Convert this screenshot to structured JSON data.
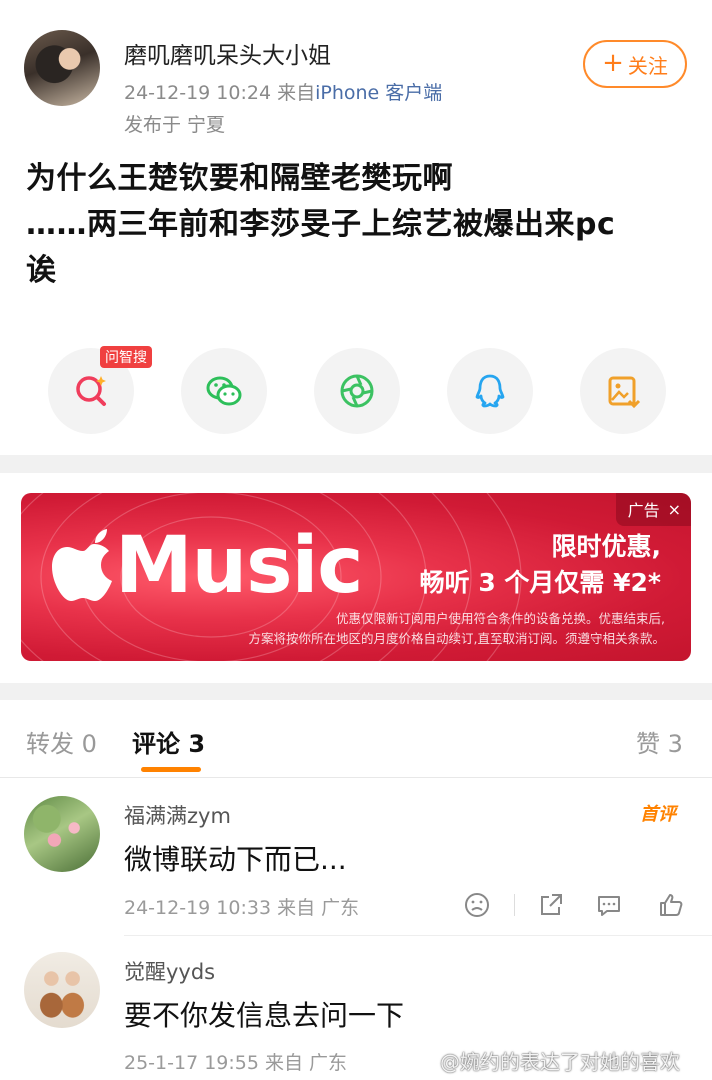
{
  "post": {
    "username": "磨叽磨叽呆头大小姐",
    "time": "24-12-19 10:24",
    "from": "来自",
    "client": "iPhone 客户端",
    "location": "发布于 宁夏",
    "follow_label": "关注",
    "text_lines": [
      "为什么王楚钦要和隔壁老樊玩啊",
      "……两三年前和李莎旻子上综艺被爆出来pc",
      "诶"
    ]
  },
  "share": {
    "ai_badge": "问智搜",
    "items": [
      "ai-search-icon",
      "wechat-icon",
      "moments-icon",
      "qq-icon",
      "save-image-icon"
    ],
    "colors": {
      "ai": "#f03d5c",
      "wechat": "#2dbf5a",
      "moments": "#3cc262",
      "qq": "#26a5f0",
      "save": "#f0a02a"
    }
  },
  "ad": {
    "tag": "广告",
    "close": "×",
    "brand": "Music",
    "headline1": "限时优惠,",
    "headline2": "畅听 3 个月仅需 ¥2*",
    "fine1": "优惠仅限新订阅用户使用符合条件的设备兑换。优惠结束后,",
    "fine2": "方案将按你所在地区的月度价格自动续订,直至取消订阅。须遵守相关条款。"
  },
  "tabs": {
    "repost": "转发 0",
    "comments": "评论 3",
    "likes": "赞 3",
    "accent": "#ff8200"
  },
  "comments": [
    {
      "name": "福满满zym",
      "text": "微博联动下而已...",
      "time": "24-12-19 10:33",
      "from": "来自 广东",
      "badge": "首评"
    },
    {
      "name": "觉醒yyds",
      "text": "要不你发信息去问一下",
      "time": "25-1-17 19:55",
      "from": "来自 广东"
    }
  ],
  "watermark": "@婉约的表达了对她的喜欢"
}
